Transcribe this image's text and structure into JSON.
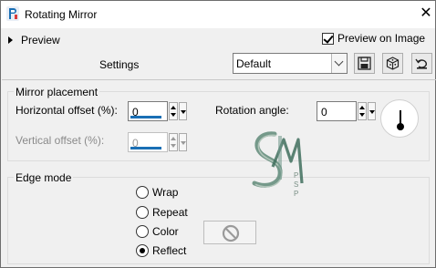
{
  "window": {
    "title": "Rotating Mirror",
    "accent": "#1a6fb5",
    "icons": [
      "app-icon",
      "close-icon"
    ]
  },
  "top": {
    "preview_label": "Preview",
    "preview_on_image_label": "Preview on Image",
    "preview_on_image_checked": true
  },
  "settings": {
    "label": "Settings",
    "selected": "Default",
    "buttons": [
      "save-preset-icon",
      "randomize-icon",
      "reset-icon"
    ]
  },
  "mirror": {
    "legend": "Mirror placement",
    "h_offset_label": "Horizontal offset (%):",
    "h_offset_value": "0",
    "v_offset_label": "Vertical offset (%):",
    "v_offset_value": "0",
    "rotation_label": "Rotation angle:",
    "rotation_value": "0"
  },
  "edge": {
    "legend": "Edge mode",
    "options": [
      "Wrap",
      "Repeat",
      "Color",
      "Reflect"
    ],
    "selected": "Reflect"
  },
  "watermark": {
    "letters": "PSP"
  }
}
